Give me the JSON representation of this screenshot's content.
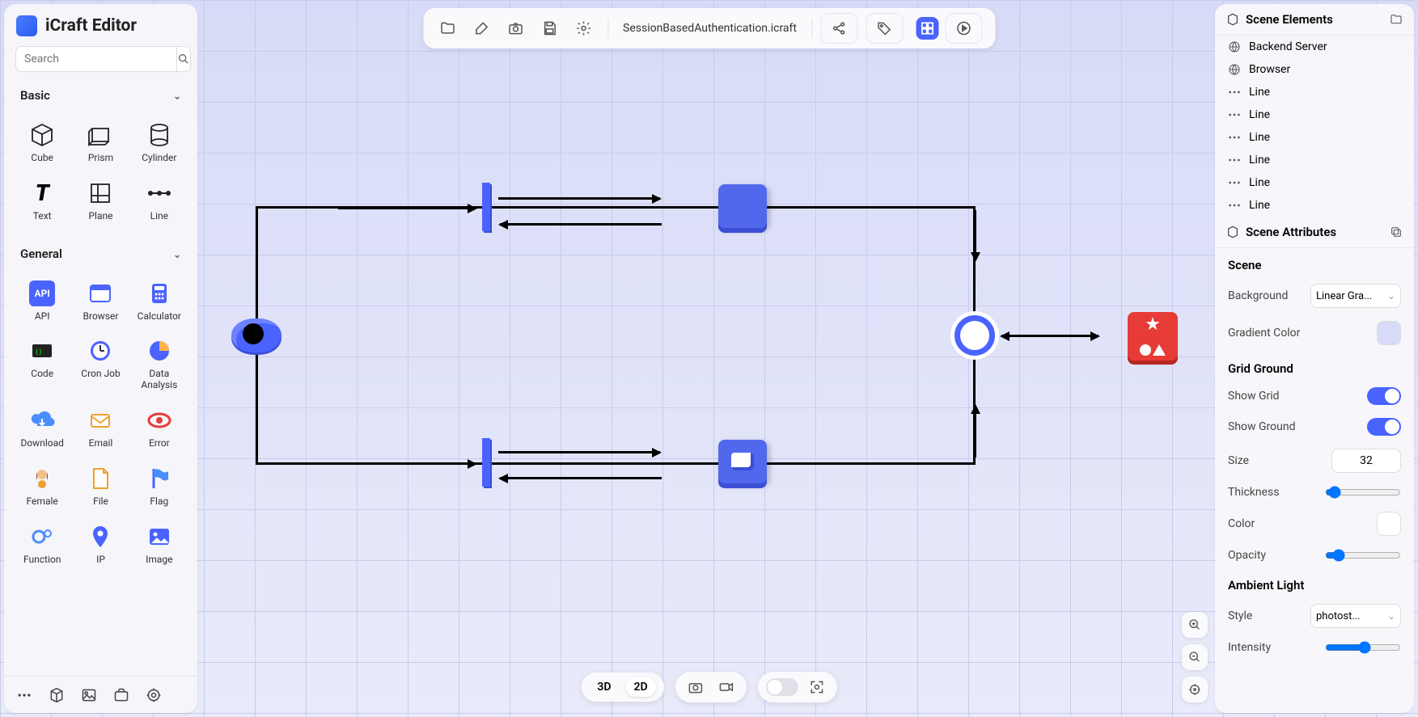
{
  "app_title": "iCraft Editor",
  "search_placeholder": "Search",
  "sections": {
    "basic": {
      "title": "Basic",
      "items": [
        {
          "label": "Cube"
        },
        {
          "label": "Prism"
        },
        {
          "label": "Cylinder"
        },
        {
          "label": "Text"
        },
        {
          "label": "Plane"
        },
        {
          "label": "Line"
        }
      ]
    },
    "general": {
      "title": "General",
      "items": [
        {
          "label": "API"
        },
        {
          "label": "Browser"
        },
        {
          "label": "Calculator"
        },
        {
          "label": "Code"
        },
        {
          "label": "Cron Job"
        },
        {
          "label": "Data Analysis"
        },
        {
          "label": "Download"
        },
        {
          "label": "Email"
        },
        {
          "label": "Error"
        },
        {
          "label": "Female"
        },
        {
          "label": "File"
        },
        {
          "label": "Flag"
        },
        {
          "label": "Function"
        },
        {
          "label": "IP"
        },
        {
          "label": "Image"
        }
      ]
    }
  },
  "filename": "SessionBasedAuthentication.icraft",
  "scene_elements_title": "Scene Elements",
  "elements": [
    {
      "icon": "globe",
      "label": "Backend Server"
    },
    {
      "icon": "globe",
      "label": "Browser"
    },
    {
      "icon": "line",
      "label": "Line"
    },
    {
      "icon": "line",
      "label": "Line"
    },
    {
      "icon": "line",
      "label": "Line"
    },
    {
      "icon": "line",
      "label": "Line"
    },
    {
      "icon": "line",
      "label": "Line"
    },
    {
      "icon": "line",
      "label": "Line"
    }
  ],
  "scene_attrs_title": "Scene Attributes",
  "attrs": {
    "scene_header": "Scene",
    "background_label": "Background",
    "background_value": "Linear Gra...",
    "gradient_color_label": "Gradient Color",
    "grid_ground_header": "Grid Ground",
    "show_grid_label": "Show Grid",
    "show_ground_label": "Show Ground",
    "size_label": "Size",
    "size_value": "32",
    "thickness_label": "Thickness",
    "color_label": "Color",
    "opacity_label": "Opacity",
    "ambient_header": "Ambient Light",
    "style_label": "Style",
    "style_value": "photost...",
    "intensity_label": "Intensity"
  },
  "view": {
    "mode_3d": "3D",
    "mode_2d": "2D"
  },
  "colors": {
    "accent": "#4a63ff",
    "danger": "#e63b36"
  }
}
